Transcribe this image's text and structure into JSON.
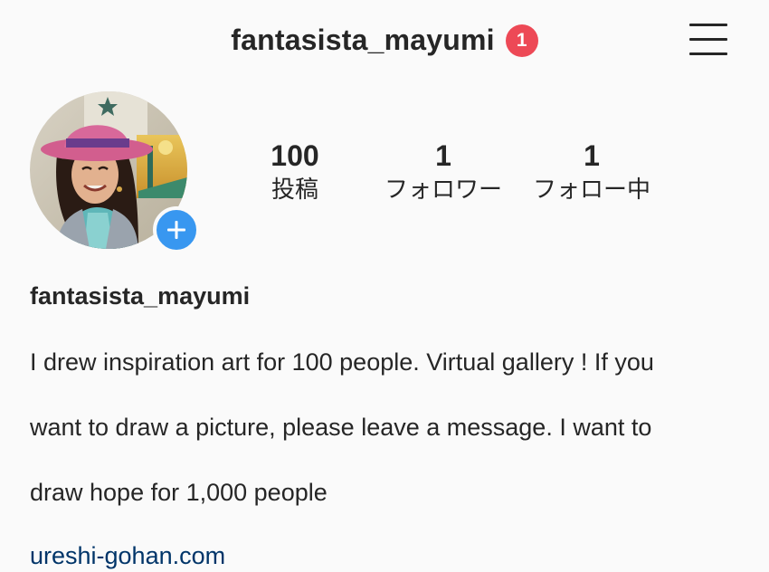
{
  "header": {
    "username": "fantasista_mayumi",
    "notification_count": "1",
    "menu_icon": "hamburger-menu-icon"
  },
  "profile": {
    "avatar_icon": "profile-photo",
    "add_story_icon": "plus-icon",
    "stats": [
      {
        "count": "100",
        "label": "投稿"
      },
      {
        "count": "1",
        "label": "フォロワー"
      },
      {
        "count": "1",
        "label": "フォロー中"
      }
    ]
  },
  "bio": {
    "name": "fantasista_mayumi",
    "lines": [
      "I drew inspiration art for 100 people. Virtual gallery ! If you",
      "want to draw a picture, please leave a message. I want to",
      "draw hope for 1,000 people"
    ],
    "link": "ureshi-gohan.com"
  },
  "colors": {
    "background": "#fafafa",
    "text": "#262626",
    "badge": "#ed4956",
    "add_button": "#3897f0",
    "link": "#003569"
  }
}
